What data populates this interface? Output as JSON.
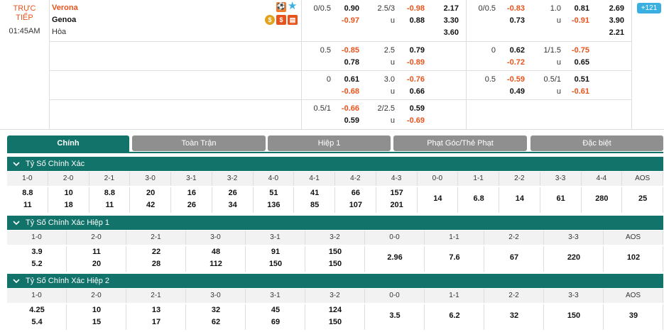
{
  "match": {
    "status_line1": "TRỰC",
    "status_line2": "TIẾP",
    "time": "01:45AM",
    "home": "Verona",
    "away": "Genoa",
    "draw": "Hòa",
    "more_count": "121",
    "colors": {
      "accent": "#12736a",
      "home_red": "#e8531c",
      "badge_blue": "#3ab0e2"
    }
  },
  "odds_rows": [
    {
      "ft_hcp": "0/0.5",
      "ft_h1": "0.90",
      "ft_h2": "-0.97",
      "ft_ou": "2.5/3",
      "ft_o1": "-0.98",
      "ft_u": "u",
      "ft_o2": "0.88",
      "ft_1x2_1": "2.17",
      "ft_1x2_2": "3.30",
      "ft_1x2_x": "3.60",
      "h1_hcp": "0/0.5",
      "h1_h1": "-0.83",
      "h1_h2": "0.73",
      "h1_ou": "1.0",
      "h1_o1": "0.81",
      "h1_u": "u",
      "h1_o2": "-0.91",
      "h1_1x2_1": "2.69",
      "h1_1x2_2": "3.90",
      "h1_1x2_x": "2.21"
    },
    {
      "ft_hcp": "0.5",
      "ft_h1": "-0.85",
      "ft_h2": "0.78",
      "ft_ou": "2.5",
      "ft_o1": "0.79",
      "ft_u": "u",
      "ft_o2": "-0.89",
      "h1_hcp": "0",
      "h1_h1": "0.62",
      "h1_h2": "-0.72",
      "h1_ou": "1/1.5",
      "h1_o1": "-0.75",
      "h1_u": "u",
      "h1_o2": "0.65"
    },
    {
      "ft_hcp": "0",
      "ft_h1": "0.61",
      "ft_h2": "-0.68",
      "ft_ou": "3.0",
      "ft_o1": "-0.76",
      "ft_u": "u",
      "ft_o2": "0.66",
      "h1_hcp": "0.5",
      "h1_h1": "-0.59",
      "h1_h2": "0.49",
      "h1_ou": "0.5/1",
      "h1_o1": "0.51",
      "h1_u": "u",
      "h1_o2": "-0.61"
    },
    {
      "ft_hcp": "0.5/1",
      "ft_h1": "-0.66",
      "ft_h2": "0.59",
      "ft_ou": "2/2.5",
      "ft_o1": "0.59",
      "ft_u": "u",
      "ft_o2": "-0.69"
    }
  ],
  "tabs": [
    "Chính",
    "Toàn Trận",
    "Hiệp 1",
    "Phạt Góc/Thẻ Phạt",
    "Đặc biệt"
  ],
  "sections": [
    {
      "title": "Tỷ Số Chính Xác",
      "headers": [
        "1-0",
        "2-0",
        "2-1",
        "3-0",
        "3-1",
        "3-2",
        "4-0",
        "4-1",
        "4-2",
        "4-3",
        "0-0",
        "1-1",
        "2-2",
        "3-3",
        "4-4",
        "AOS"
      ],
      "row1": [
        "8.8",
        "10",
        "8.8",
        "20",
        "16",
        "26",
        "51",
        "41",
        "66",
        "157",
        "14",
        "6.8",
        "14",
        "61",
        "280",
        "25"
      ],
      "row2": [
        "11",
        "18",
        "11",
        "42",
        "26",
        "34",
        "136",
        "85",
        "107",
        "201",
        "",
        "",
        "",
        "",
        "",
        ""
      ]
    },
    {
      "title": "Tỷ Số Chính Xác Hiệp 1",
      "headers": [
        "1-0",
        "2-0",
        "2-1",
        "3-0",
        "3-1",
        "3-2",
        "0-0",
        "1-1",
        "2-2",
        "3-3",
        "AOS"
      ],
      "row1": [
        "3.9",
        "11",
        "22",
        "48",
        "91",
        "150",
        "2.96",
        "7.6",
        "67",
        "220",
        "102"
      ],
      "row2": [
        "5.2",
        "20",
        "28",
        "112",
        "150",
        "150",
        "",
        "",
        "",
        "",
        ""
      ]
    },
    {
      "title": "Tỷ Số Chính Xác Hiệp 2",
      "headers": [
        "1-0",
        "2-0",
        "2-1",
        "3-0",
        "3-1",
        "3-2",
        "0-0",
        "1-1",
        "2-2",
        "3-3",
        "AOS"
      ],
      "row1": [
        "4.25",
        "10",
        "13",
        "32",
        "45",
        "124",
        "3.5",
        "6.2",
        "32",
        "150",
        "39"
      ],
      "row2": [
        "5.4",
        "15",
        "17",
        "62",
        "69",
        "150",
        "",
        "",
        "",
        "",
        ""
      ]
    }
  ]
}
